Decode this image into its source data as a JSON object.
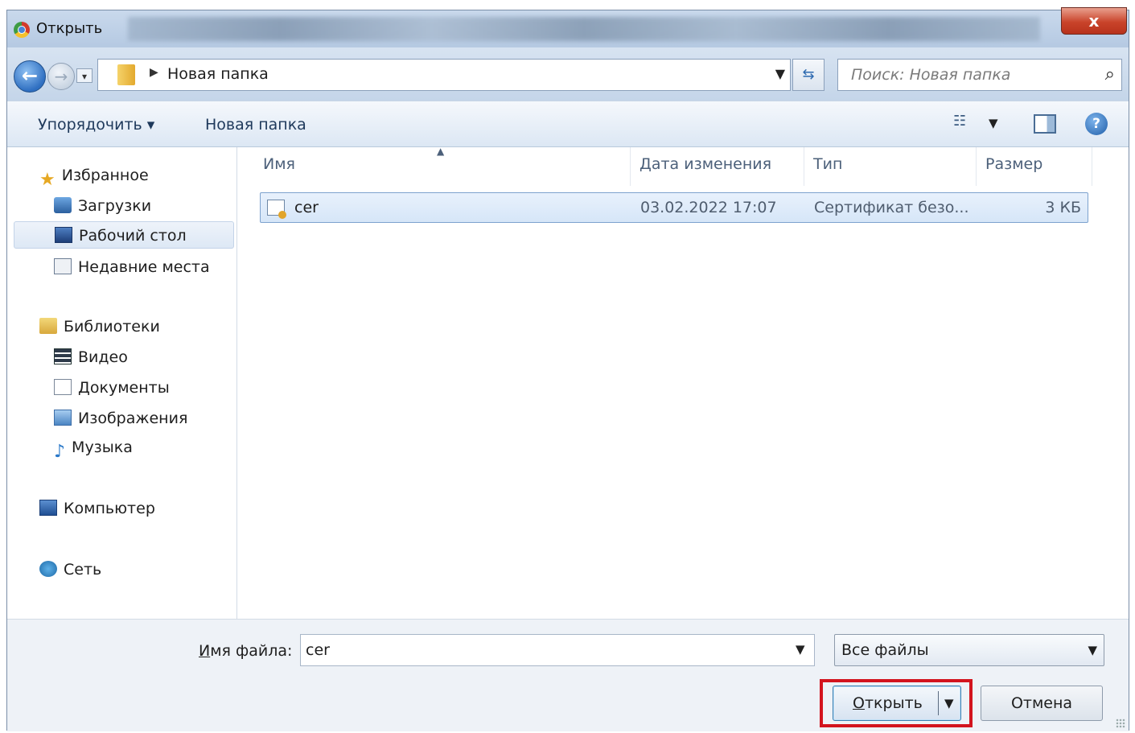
{
  "window": {
    "title": "Открыть",
    "close_label": "x"
  },
  "nav": {
    "address": "Новая папка",
    "search_placeholder": "Поиск: Новая папка"
  },
  "toolbar": {
    "organize": "Упорядочить ▾",
    "new_folder": "Новая папка"
  },
  "sidebar": {
    "favorites": "Избранное",
    "downloads": "Загрузки",
    "desktop": "Рабочий стол",
    "recent": "Недавние места",
    "libraries": "Библиотеки",
    "video": "Видео",
    "documents": "Документы",
    "images": "Изображения",
    "music": "Музыка",
    "computer": "Компьютер",
    "network": "Сеть"
  },
  "columns": {
    "name": "Имя",
    "date": "Дата изменения",
    "type": "Тип",
    "size": "Размер"
  },
  "files": [
    {
      "name": "cer",
      "date": "03.02.2022 17:07",
      "type": "Сертификат безо...",
      "size": "3 КБ"
    }
  ],
  "bottom": {
    "filename_label_underlined": "И",
    "filename_label_rest": "мя файла:",
    "filename_value": "cer",
    "filter": "Все файлы",
    "open_underlined": "О",
    "open_rest": "ткрыть",
    "cancel": "Отмена"
  }
}
